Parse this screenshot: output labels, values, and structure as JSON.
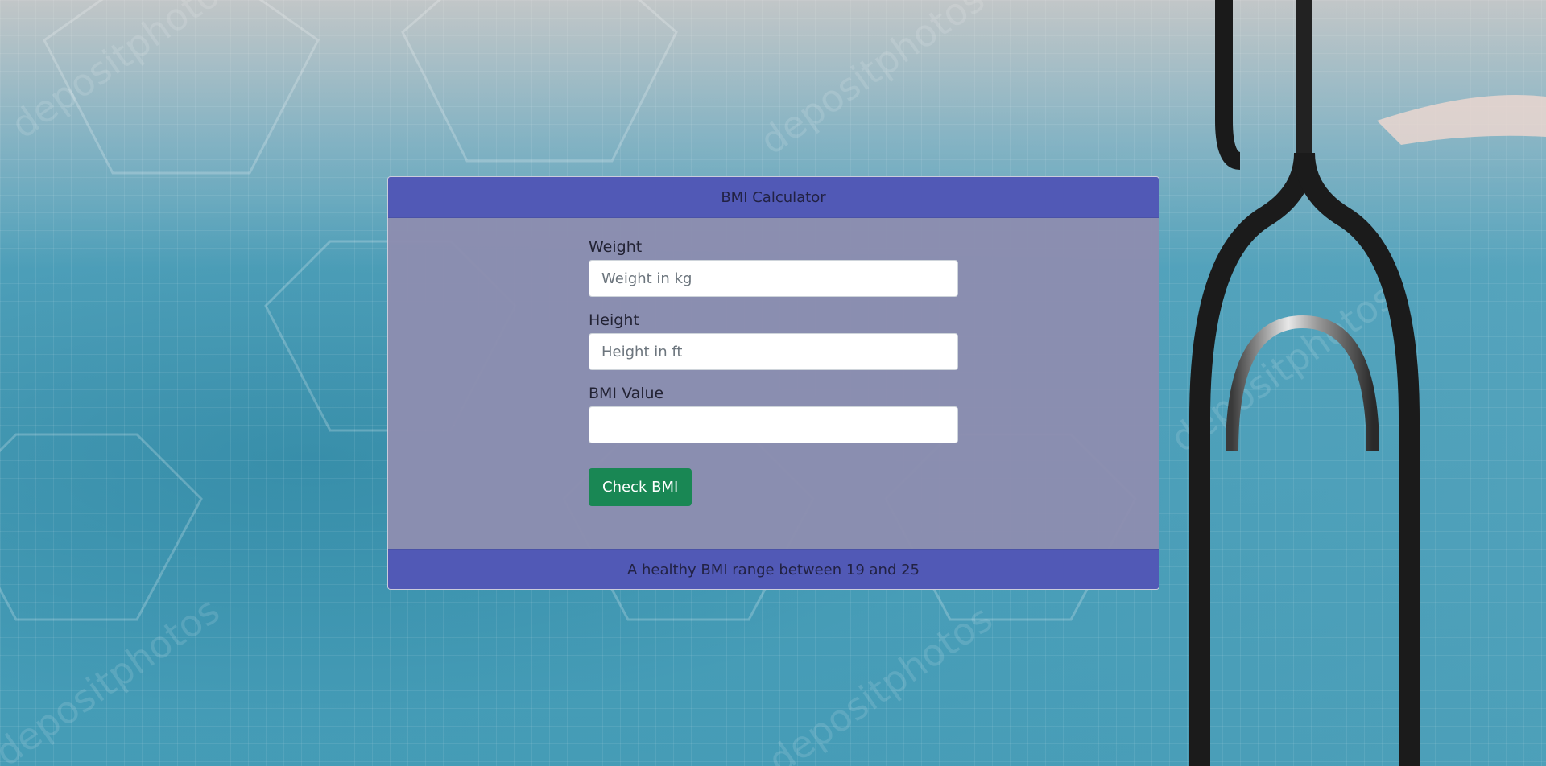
{
  "card": {
    "title": "BMI Calculator",
    "footer_text": "A healthy BMI range between 19 and 25"
  },
  "fields": {
    "weight": {
      "label": "Weight",
      "placeholder": "Weight in kg",
      "value": ""
    },
    "height": {
      "label": "Height",
      "placeholder": "Height in ft",
      "value": ""
    },
    "bmi": {
      "label": "BMI Value",
      "placeholder": "",
      "value": ""
    }
  },
  "actions": {
    "check_label": "Check BMI"
  },
  "background": {
    "watermark": "depositphotos"
  },
  "colors": {
    "header_bg": "#5159b6",
    "card_body_bg": "#8c8db0",
    "button_bg": "#198754"
  }
}
